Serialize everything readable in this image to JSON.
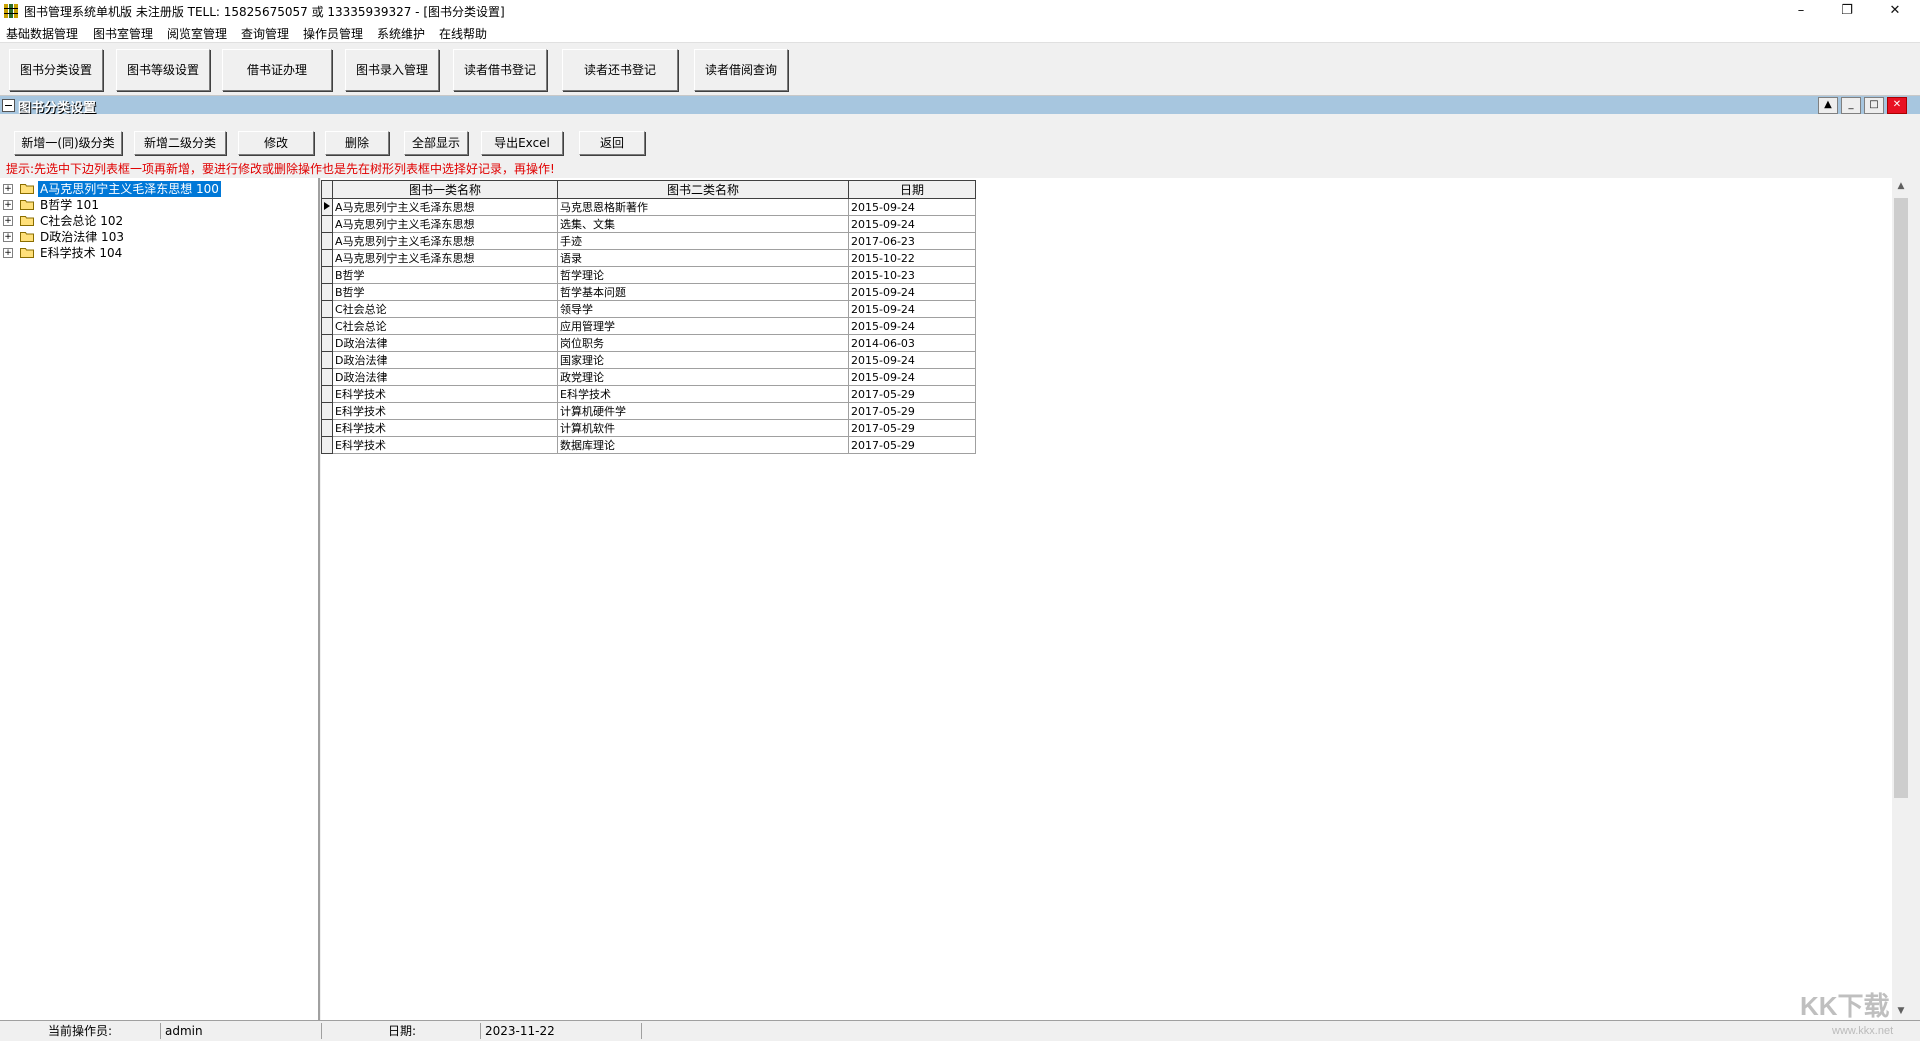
{
  "window": {
    "title": "图书管理系统单机版 未注册版 TELL: 15825675057 或 13335939327 - [图书分类设置]",
    "minimize": "–",
    "restore": "❐",
    "close": "✕"
  },
  "menu": [
    "基础数据管理",
    "图书室管理",
    "阅览室管理",
    "查询管理",
    "操作员管理",
    "系统维护",
    "在线帮助"
  ],
  "toolbar": [
    "图书分类设置",
    "图书等级设置",
    "借书证办理",
    "图书录入管理",
    "读者借书登记",
    "读者还书登记",
    "读者借阅查询"
  ],
  "child": {
    "title": "图书分类设置",
    "buttons": [
      "新增一(同)级分类",
      "新增二级分类",
      "修改",
      "删除",
      "全部显示",
      "导出Excel",
      "返回"
    ],
    "hint": "提示:先选中下边列表框一项再新增，要进行修改或删除操作也是先在树形列表框中选择好记录，再操作!"
  },
  "tree": [
    {
      "label": "A马克思列宁主义毛泽东思想  100",
      "selected": true
    },
    {
      "label": "B哲学  101",
      "selected": false
    },
    {
      "label": "C社会总论  102",
      "selected": false
    },
    {
      "label": "D政治法律  103",
      "selected": false
    },
    {
      "label": "E科学技术  104",
      "selected": false
    }
  ],
  "grid": {
    "columns": [
      "图书一类名称",
      "图书二类名称",
      "日期"
    ],
    "rows": [
      [
        "A马克思列宁主义毛泽东思想",
        "马克思恩格斯著作",
        "2015-09-24"
      ],
      [
        "A马克思列宁主义毛泽东思想",
        "选集、文集",
        "2015-09-24"
      ],
      [
        "A马克思列宁主义毛泽东思想",
        "手迹",
        "2017-06-23"
      ],
      [
        "A马克思列宁主义毛泽东思想",
        "语录",
        "2015-10-22"
      ],
      [
        "B哲学",
        "哲学理论",
        "2015-10-23"
      ],
      [
        "B哲学",
        "哲学基本问题",
        "2015-09-24"
      ],
      [
        "C社会总论",
        "领导学",
        "2015-09-24"
      ],
      [
        "C社会总论",
        "应用管理学",
        "2015-09-24"
      ],
      [
        "D政治法律",
        "岗位职务",
        "2014-06-03"
      ],
      [
        "D政治法律",
        "国家理论",
        "2015-09-24"
      ],
      [
        "D政治法律",
        "政党理论",
        "2015-09-24"
      ],
      [
        "E科学技术",
        "E科学技术",
        "2017-05-29"
      ],
      [
        "E科学技术",
        "计算机硬件学",
        "2017-05-29"
      ],
      [
        "E科学技术",
        "计算机软件",
        "2017-05-29"
      ],
      [
        "E科学技术",
        "数据库理论",
        "2017-05-29"
      ]
    ]
  },
  "status": {
    "operator_label": "当前操作员:",
    "operator": "admin",
    "date_label": "日期:",
    "date": "2023-11-22"
  },
  "watermark": {
    "main": "KK下载",
    "sub": "www.kkx.net"
  },
  "colors": {
    "caption": "#a7c6df",
    "hint": "#e00000",
    "selection": "#0078d7"
  }
}
